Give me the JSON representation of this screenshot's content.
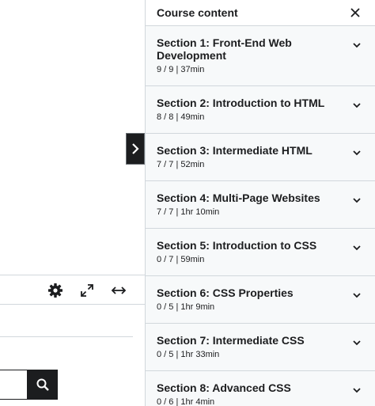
{
  "sidebar": {
    "title": "Course content",
    "sections": [
      {
        "title": "Section 1: Front-End Web Development",
        "meta": "9 / 9 | 37min"
      },
      {
        "title": "Section 2: Introduction to HTML",
        "meta": "8 / 8 | 49min"
      },
      {
        "title": "Section 3: Intermediate HTML",
        "meta": "7 / 7 | 52min"
      },
      {
        "title": "Section 4: Multi-Page Websites",
        "meta": "7 / 7 | 1hr 10min"
      },
      {
        "title": "Section 5: Introduction to CSS",
        "meta": "0 / 7 | 59min"
      },
      {
        "title": "Section 6: CSS Properties",
        "meta": "0 / 5 | 1hr 9min"
      },
      {
        "title": "Section 7: Intermediate CSS",
        "meta": "0 / 5 | 1hr 33min"
      },
      {
        "title": "Section 8: Advanced CSS",
        "meta": "0 / 6 | 1hr 4min"
      }
    ]
  },
  "icons": {
    "expand_tab": "chevron-right-icon",
    "settings": "gear-icon",
    "fullscreen": "expand-icon",
    "wide": "horizontal-arrows-icon",
    "search": "search-icon",
    "close": "close-icon",
    "section_toggle": "chevron-down-icon"
  }
}
